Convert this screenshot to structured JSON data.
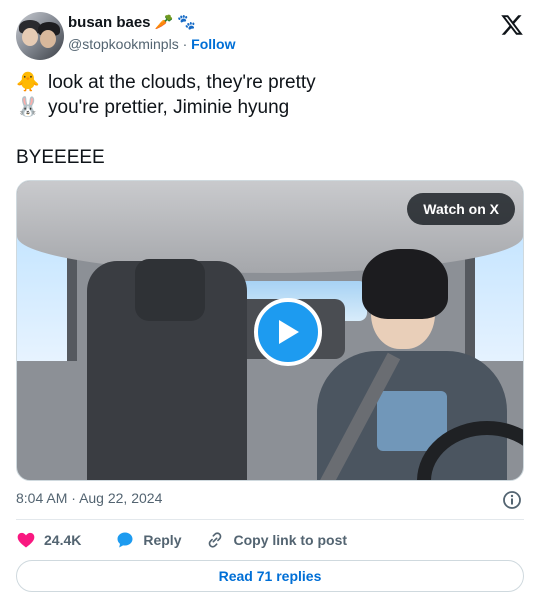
{
  "author": {
    "display_name": "busan baes",
    "name_emojis": [
      "🥕",
      "🐾"
    ],
    "handle": "@stopkookminpls",
    "separator": "·",
    "follow_label": "Follow"
  },
  "brand_icon": "x-logo-icon",
  "tweet": {
    "lines": [
      {
        "emoji": "🐥",
        "text": "look at the clouds, they're pretty"
      },
      {
        "emoji": "🐰",
        "text": "you're prettier, Jiminie hyung"
      }
    ],
    "closing": "BYEEEEE"
  },
  "media": {
    "type": "video",
    "watch_label": "Watch on X",
    "play_icon": "play-icon"
  },
  "meta": {
    "time": "8:04 AM",
    "separator": "·",
    "date": "Aug 22, 2024",
    "info_icon": "info-icon"
  },
  "actions": {
    "likes": "24.4K",
    "reply_label": "Reply",
    "copy_label": "Copy link to post"
  },
  "read_replies_label": "Read 71 replies",
  "colors": {
    "accent_blue": "#1d9bf0",
    "link_blue": "#006fd6",
    "like_pink": "#f91880",
    "muted_text": "#536471",
    "border": "#cfd9de"
  }
}
